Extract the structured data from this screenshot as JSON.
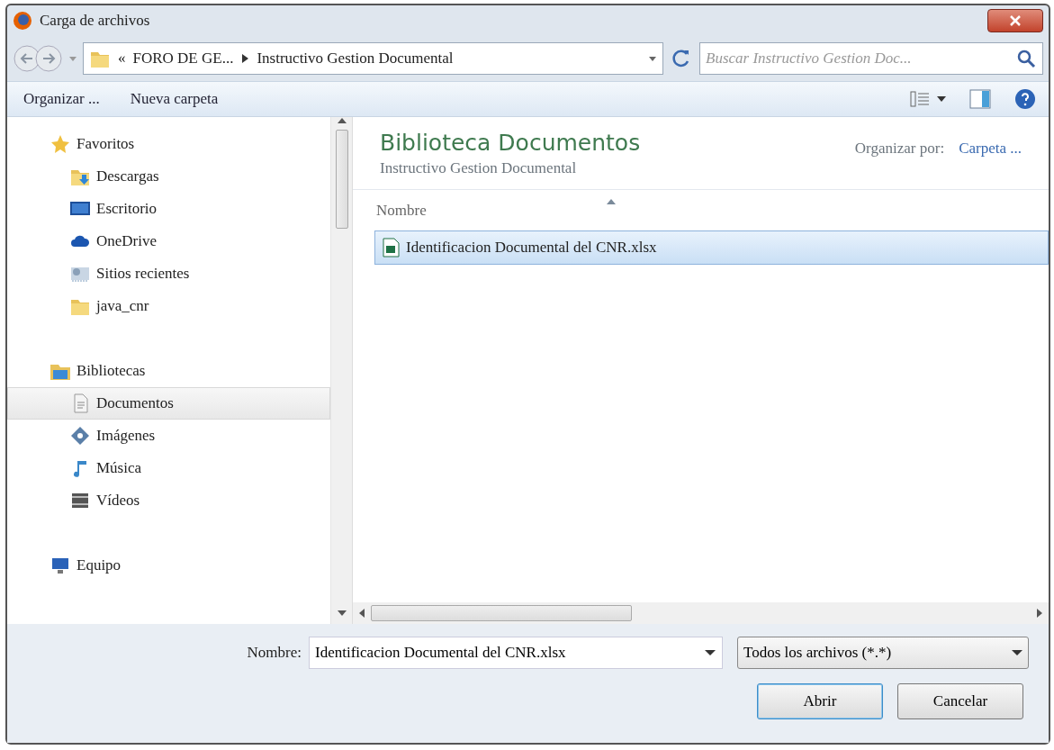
{
  "window": {
    "title": "Carga de archivos"
  },
  "address_bar": {
    "overflow": "«",
    "crumbs": [
      "FORO DE GE...",
      "Instructivo Gestion Documental"
    ]
  },
  "search": {
    "placeholder": "Buscar Instructivo Gestion Doc..."
  },
  "toolbar": {
    "buttons": [
      "Organizar ...",
      "Nueva carpeta"
    ]
  },
  "sidebar": {
    "items": [
      {
        "label": "Favoritos",
        "kind": "star",
        "selected": false,
        "children": [
          {
            "label": "Descargas",
            "kind": "download",
            "selected": false
          },
          {
            "label": "Escritorio",
            "kind": "desktop",
            "selected": false
          },
          {
            "label": "OneDrive",
            "kind": "cloud",
            "selected": false
          },
          {
            "label": "Sitios recientes",
            "kind": "recent",
            "selected": false
          },
          {
            "label": "java_cnr",
            "kind": "folder",
            "selected": false
          }
        ]
      },
      {
        "label": "Bibliotecas",
        "kind": "library",
        "selected": false,
        "children": [
          {
            "label": "Documentos",
            "kind": "document",
            "selected": true
          },
          {
            "label": "Imágenes",
            "kind": "image",
            "selected": false
          },
          {
            "label": "Música",
            "kind": "music",
            "selected": false
          },
          {
            "label": "Vídeos",
            "kind": "video",
            "selected": false
          }
        ]
      },
      {
        "label": "Equipo",
        "kind": "computer",
        "selected": false
      }
    ]
  },
  "content": {
    "title": "Biblioteca Documentos",
    "subtitle": "Instructivo Gestion Documental",
    "arrange_label": "Organizar por:",
    "arrange_value": "Carpeta ...",
    "columns": [
      "Nombre"
    ],
    "files": [
      {
        "name": "Identificacion Documental del CNR.xlsx",
        "selected": true
      }
    ]
  },
  "footer": {
    "name_label": "Nombre:",
    "name_value": "Identificacion Documental del CNR.xlsx",
    "filter": "Todos los archivos (*.*)",
    "buttons": [
      "Abrir",
      "Cancelar"
    ]
  }
}
